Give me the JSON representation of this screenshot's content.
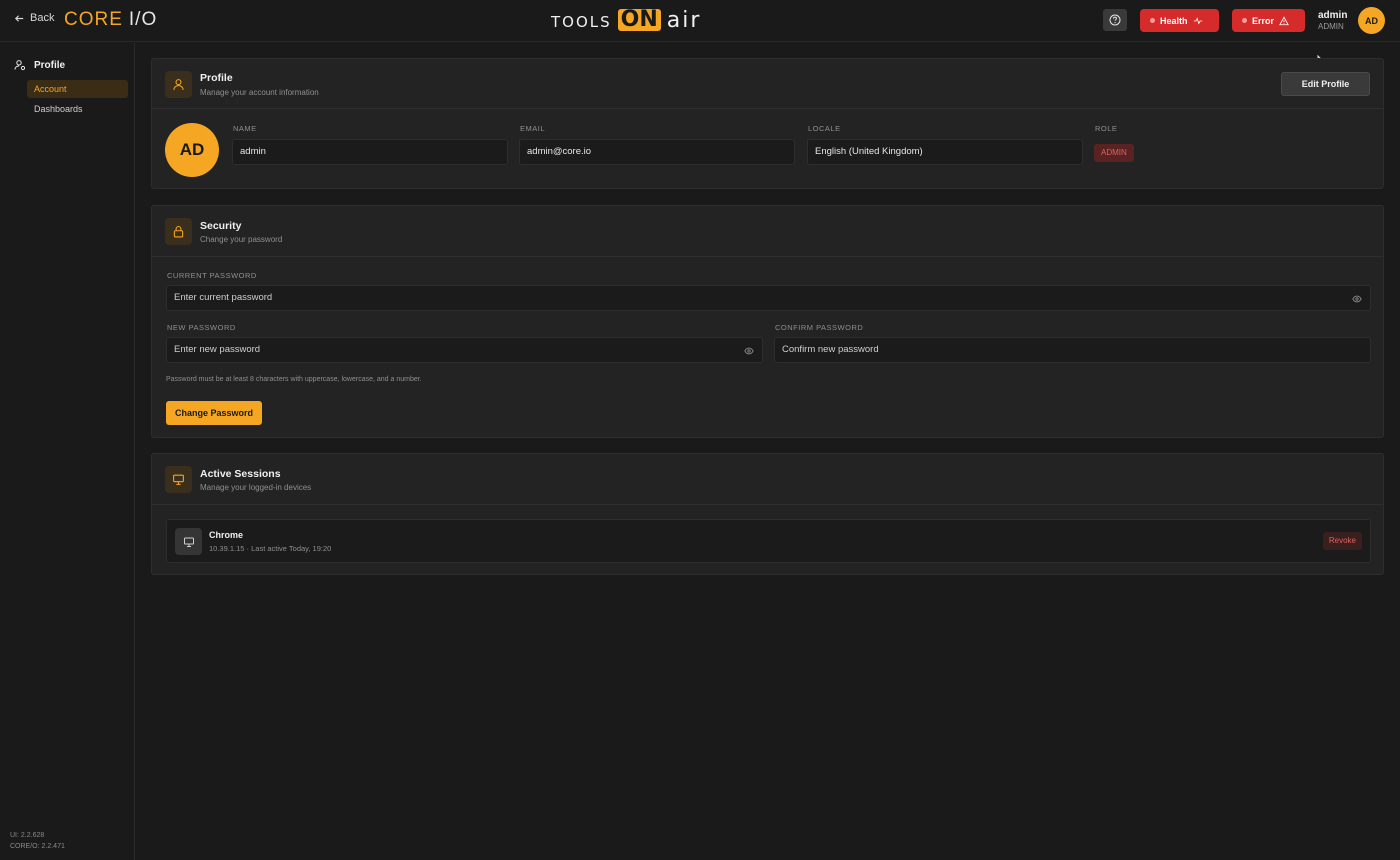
{
  "header": {
    "back_label": "Back",
    "logo_core": "CORE",
    "logo_io": "I/O",
    "brand_left": "TOOLS",
    "brand_on": "ON",
    "brand_right": "air",
    "health_label": "Health",
    "error_label": "Error",
    "user_name": "admin",
    "user_role": "ADMIN",
    "avatar_initials": "AD"
  },
  "sidebar": {
    "section": "Profile",
    "items": [
      {
        "label": "Account",
        "active": true
      },
      {
        "label": "Dashboards",
        "active": false
      }
    ],
    "version_ui": "UI: 2.2.628",
    "version_core": "CORE/O: 2.2.471"
  },
  "profile": {
    "title": "Profile",
    "subtitle": "Manage your account information",
    "edit_label": "Edit Profile",
    "avatar_initials": "AD",
    "name_label": "NAME",
    "name_value": "admin",
    "email_label": "EMAIL",
    "email_value": "admin@core.io",
    "locale_label": "LOCALE",
    "locale_value": "English (United Kingdom)",
    "role_label": "ROLE",
    "role_value": "ADMIN"
  },
  "security": {
    "title": "Security",
    "subtitle": "Change your password",
    "current_label": "CURRENT PASSWORD",
    "current_placeholder": "Enter current password",
    "new_label": "NEW PASSWORD",
    "new_placeholder": "Enter new password",
    "confirm_label": "CONFIRM PASSWORD",
    "confirm_placeholder": "Confirm new password",
    "hint": "Password must be at least 8 characters with uppercase, lowercase, and a number.",
    "change_label": "Change Password"
  },
  "sessions": {
    "title": "Active Sessions",
    "subtitle": "Manage your logged-in devices",
    "items": [
      {
        "name": "Chrome",
        "meta": "10.39.1.15 · Last active Today, 19:20",
        "action": "Revoke"
      }
    ]
  },
  "colors": {
    "accent": "#f5a623",
    "danger": "#d62b2b",
    "background": "#1a1a1a",
    "card": "#232323"
  }
}
